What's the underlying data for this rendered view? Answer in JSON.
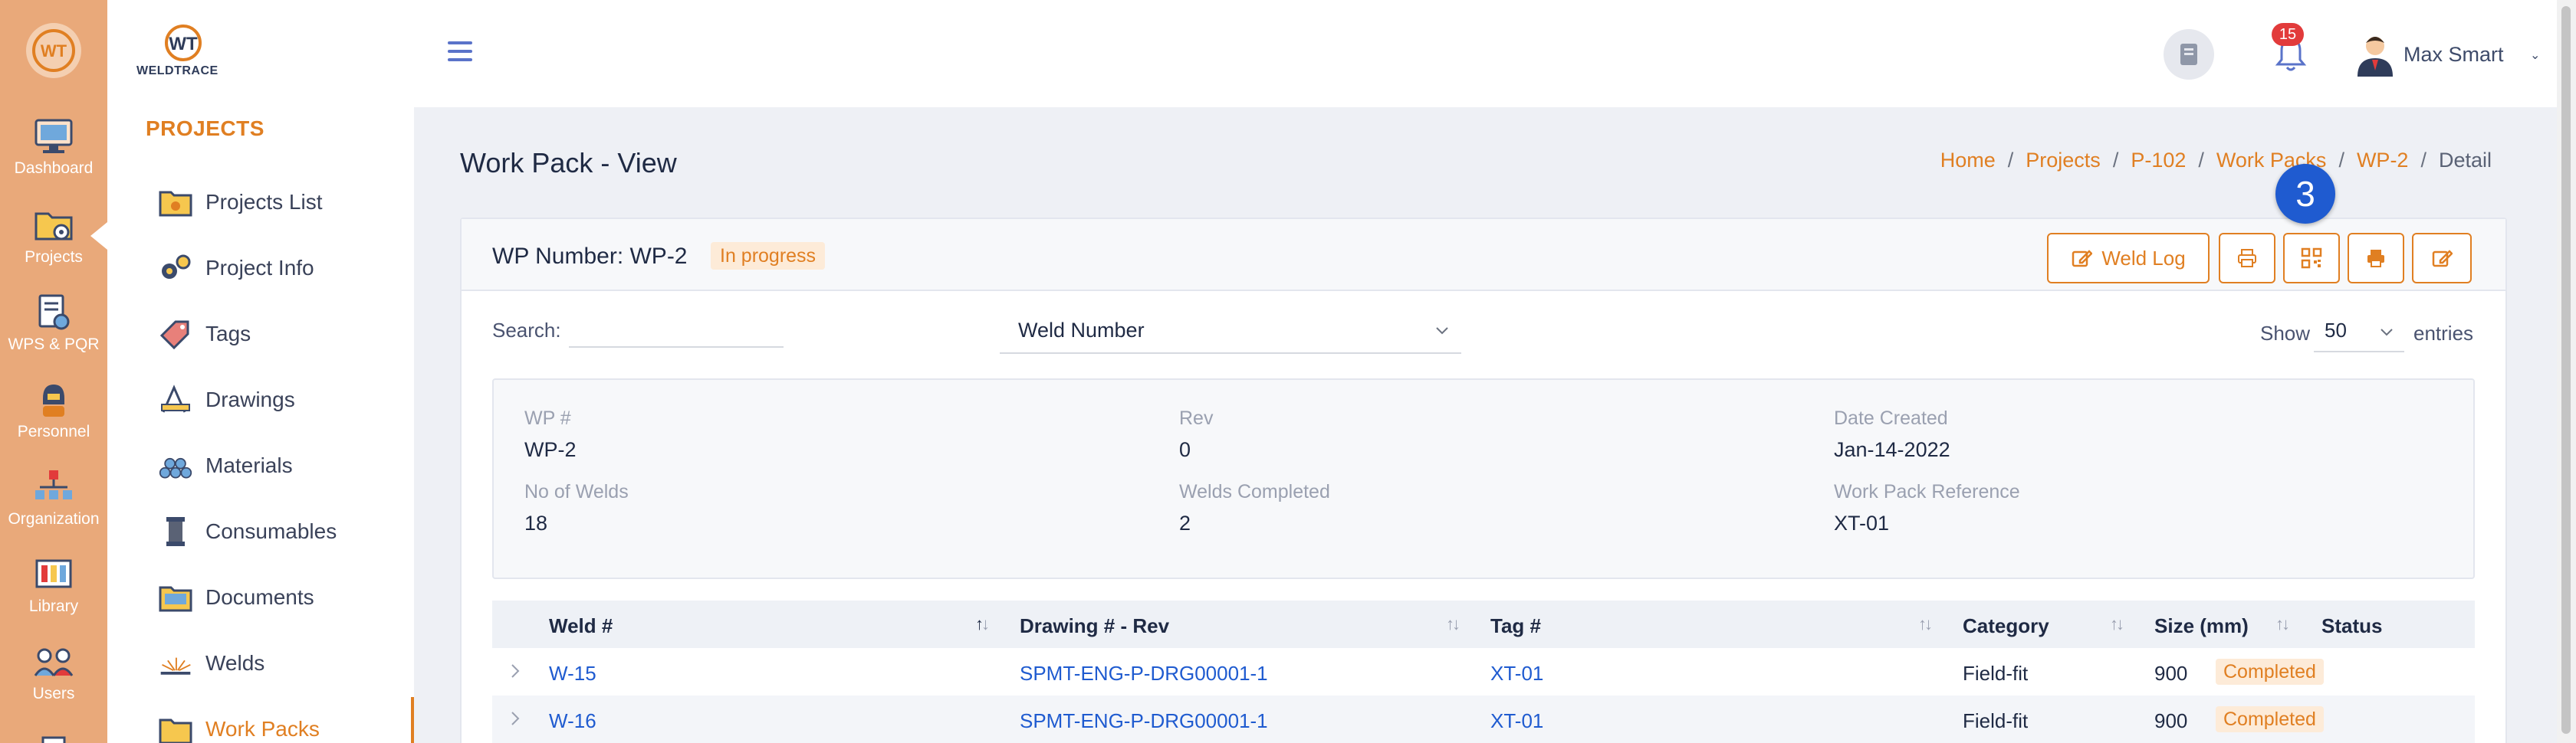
{
  "rail": {
    "items": [
      {
        "label": "Dashboard",
        "icon": "monitor-icon"
      },
      {
        "label": "Projects",
        "icon": "folder-gear-icon"
      },
      {
        "label": "WPS & PQR",
        "icon": "document-settings-icon"
      },
      {
        "label": "Personnel",
        "icon": "welder-icon"
      },
      {
        "label": "Organization",
        "icon": "organization-icon"
      },
      {
        "label": "Library",
        "icon": "library-icon"
      },
      {
        "label": "Users",
        "icon": "users-icon"
      }
    ]
  },
  "brand": {
    "name": "WELDTRACE"
  },
  "sidebar": {
    "section": "PROJECTS",
    "items": [
      {
        "label": "Projects List",
        "icon": "folder-icon"
      },
      {
        "label": "Project Info",
        "icon": "gears-icon"
      },
      {
        "label": "Tags",
        "icon": "tag-icon"
      },
      {
        "label": "Drawings",
        "icon": "drawing-tools-icon"
      },
      {
        "label": "Materials",
        "icon": "pipes-icon"
      },
      {
        "label": "Consumables",
        "icon": "spool-icon"
      },
      {
        "label": "Documents",
        "icon": "documents-icon"
      },
      {
        "label": "Welds",
        "icon": "weld-spark-icon"
      },
      {
        "label": "Work Packs",
        "icon": "work-pack-icon"
      }
    ],
    "active": "Work Packs"
  },
  "topbar": {
    "notifications_count": "15",
    "user_name": "Max Smart"
  },
  "page": {
    "title": "Work Pack - View",
    "breadcrumb": [
      "Home",
      "Projects",
      "P-102",
      "Work Packs",
      "WP-2"
    ],
    "breadcrumb_current": "Detail"
  },
  "card": {
    "wp_title": "WP Number: WP-2",
    "status_badge": "In progress",
    "buttons": {
      "weld_log": "Weld Log"
    },
    "step_marker": "3",
    "search_label": "Search:",
    "search_value": "",
    "filter_select": "Weld Number",
    "show_label": "Show",
    "show_value": "50",
    "entries_label": "entries"
  },
  "info": {
    "wp_label": "WP #",
    "wp_value": "WP-2",
    "rev_label": "Rev",
    "rev_value": "0",
    "date_label": "Date Created",
    "date_value": "Jan-14-2022",
    "welds_label": "No of Welds",
    "welds_value": "18",
    "completed_label": "Welds Completed",
    "completed_value": "2",
    "ref_label": "Work Pack Reference",
    "ref_value": "XT-01"
  },
  "table": {
    "columns": [
      "Weld #",
      "Drawing # - Rev",
      "Tag #",
      "Category",
      "Size (mm)",
      "Status"
    ],
    "rows": [
      {
        "weld": "W-15",
        "drawing": "SPMT-ENG-P-DRG00001-1",
        "tag": "XT-01",
        "category": "Field-fit",
        "size": "900",
        "status": "Completed"
      },
      {
        "weld": "W-16",
        "drawing": "SPMT-ENG-P-DRG00001-1",
        "tag": "XT-01",
        "category": "Field-fit",
        "size": "900",
        "status": "Completed"
      }
    ]
  },
  "colors": {
    "accent": "#e07f22",
    "rail": "#e9a97a",
    "link": "#1f5bd0",
    "badge_bg": "#fdebd8"
  }
}
